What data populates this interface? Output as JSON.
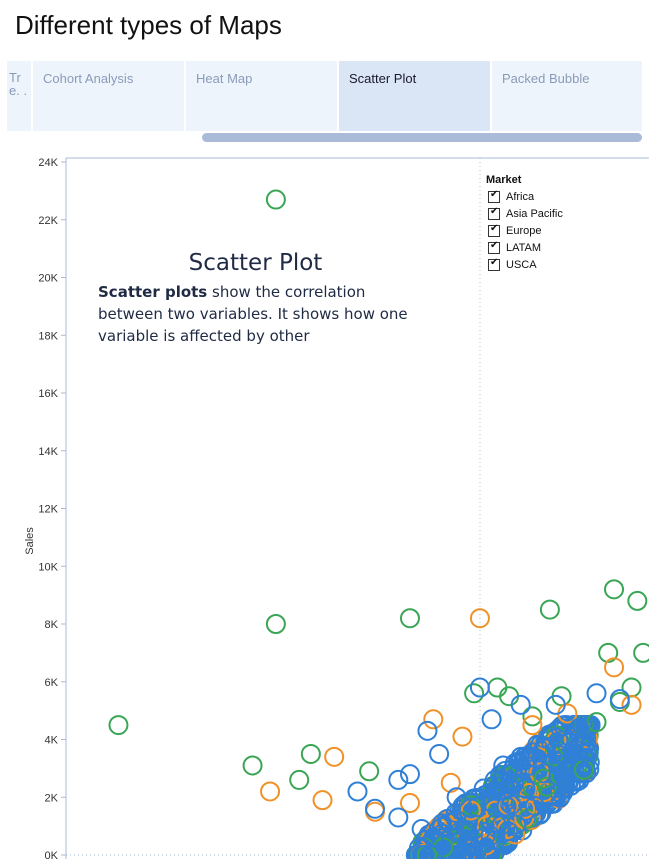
{
  "page": {
    "title": "Different types of Maps"
  },
  "tabs": [
    {
      "label": "Tr e. .",
      "active": false
    },
    {
      "label": "Cohort Analysis",
      "active": false
    },
    {
      "label": "Heat Map",
      "active": false
    },
    {
      "label": "Scatter Plot",
      "active": true
    },
    {
      "label": "Packed Bubble",
      "active": false
    }
  ],
  "annotation": {
    "title": "Scatter Plot",
    "body_bold": "Scatter plots",
    "body_rest": " show the correlation between two variables. It shows how one variable is affected by other"
  },
  "legend": {
    "title": "Market",
    "items": [
      {
        "label": "Africa",
        "checked": true
      },
      {
        "label": "Asia Pacific",
        "checked": true
      },
      {
        "label": "Europe",
        "checked": true
      },
      {
        "label": "LATAM",
        "checked": true
      },
      {
        "label": "USCA",
        "checked": true
      }
    ]
  },
  "colors": {
    "blue": "#2f80d6",
    "orange": "#f0922a",
    "green": "#3aa655",
    "axis": "#a9bbd8"
  },
  "chart_data": {
    "type": "scatter",
    "title": "Scatter Plot",
    "xlabel": "",
    "ylabel": "Sales",
    "ylim": [
      0,
      24000
    ],
    "xlim": [
      0,
      100
    ],
    "y_ticks": [
      "0K",
      "2K",
      "4K",
      "6K",
      "8K",
      "10K",
      "12K",
      "14K",
      "16K",
      "18K",
      "20K",
      "22K",
      "24K"
    ],
    "legend_position": "top-right",
    "series": [
      {
        "name": "Europe",
        "color": "green",
        "points": [
          [
            9,
            4500
          ],
          [
            36,
            22700
          ],
          [
            36,
            8000
          ],
          [
            59,
            8200
          ],
          [
            32,
            3100
          ],
          [
            40,
            2600
          ],
          [
            42,
            3500
          ],
          [
            52,
            2900
          ],
          [
            83,
            8500
          ],
          [
            94,
            9200
          ],
          [
            98,
            8800
          ],
          [
            70,
            5600
          ],
          [
            74,
            5800
          ],
          [
            76,
            5500
          ],
          [
            85,
            5500
          ],
          [
            93,
            7000
          ],
          [
            97,
            5800
          ],
          [
            99,
            7000
          ],
          [
            91,
            4600
          ],
          [
            95,
            5300
          ],
          [
            80,
            4800
          ]
        ]
      },
      {
        "name": "Africa",
        "color": "orange",
        "points": [
          [
            35,
            2200
          ],
          [
            44,
            1900
          ],
          [
            53,
            1500
          ],
          [
            71,
            8200
          ],
          [
            63,
            4700
          ],
          [
            46,
            3400
          ],
          [
            68,
            4100
          ],
          [
            80,
            4500
          ],
          [
            94,
            6500
          ],
          [
            97,
            5200
          ],
          [
            86,
            4900
          ],
          [
            59,
            1800
          ],
          [
            66,
            2500
          ]
        ]
      },
      {
        "name": "USCA",
        "color": "blue",
        "points": [
          [
            57,
            2600
          ],
          [
            62,
            4300
          ],
          [
            57,
            1300
          ],
          [
            61,
            900
          ],
          [
            64,
            3500
          ],
          [
            71,
            5800
          ],
          [
            73,
            4700
          ],
          [
            78,
            5200
          ],
          [
            84,
            5200
          ],
          [
            91,
            5600
          ],
          [
            95,
            5400
          ],
          [
            50,
            2200
          ],
          [
            53,
            1600
          ],
          [
            59,
            2800
          ],
          [
            67,
            2000
          ],
          [
            63,
            600
          ],
          [
            75,
            3100
          ],
          [
            82,
            3700
          ],
          [
            88,
            4400
          ]
        ]
      }
    ],
    "dense_region": {
      "description": "dense blue cluster near bottom",
      "x_range": [
        60,
        90
      ],
      "y_range": [
        0,
        4500
      ]
    }
  }
}
